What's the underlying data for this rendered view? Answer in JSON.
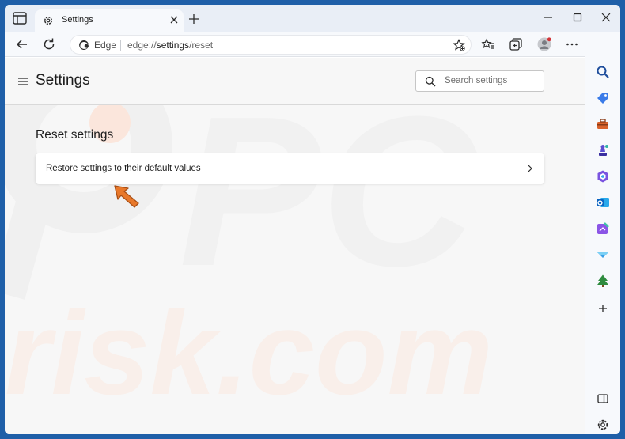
{
  "tab": {
    "title": "Settings"
  },
  "address": {
    "browser_label": "Edge",
    "url_prefix": "edge://",
    "url_main": "settings",
    "url_suffix": "/reset"
  },
  "page": {
    "title": "Settings",
    "search_placeholder": "Search settings",
    "section_title": "Reset settings",
    "restore_label": "Restore settings to their default values"
  },
  "colors": {
    "accent": "#0067c0",
    "desktop": "#1f5fa8",
    "pointer_arrow": "#e8782a"
  },
  "watermark": {
    "line1": "PC",
    "line2": "risk.com"
  },
  "icons": {
    "titlebar": [
      "tab-actions-icon",
      "settings-gear-icon",
      "close-icon",
      "plus-icon",
      "minimize-icon",
      "maximize-icon",
      "close-icon"
    ],
    "toolbar": [
      "back-arrow-icon",
      "refresh-icon",
      "edge-logo-icon",
      "favorite-star-icon",
      "favorites-icon",
      "collections-icon",
      "profile-avatar-icon",
      "more-icon",
      "copilot-icon"
    ],
    "sidebar": [
      "search-icon",
      "shopping-tag-icon",
      "tools-icon",
      "games-icon",
      "office-icon",
      "outlook-icon",
      "designer-icon",
      "drop-icon",
      "tree-icon",
      "plus-icon",
      "sidebar-toggle-icon",
      "settings-gear-icon"
    ]
  }
}
